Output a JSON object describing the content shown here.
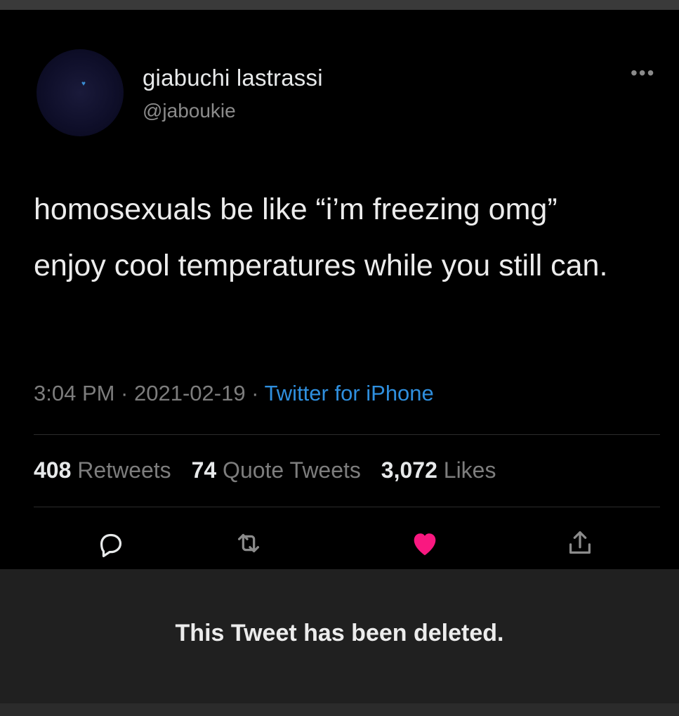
{
  "tweet": {
    "author": {
      "display_name": "giabuchi lastrassi",
      "handle": "@jaboukie",
      "avatar_icon": "avatar-image"
    },
    "more_icon": "more-horizontal-icon",
    "text": "homosexuals be like “i’m freezing omg” enjoy cool temperatures while you still can.",
    "timestamp": "3:04 PM · 2021-02-19 · ",
    "source": "Twitter for iPhone",
    "stats": {
      "retweets_count": "408",
      "retweets_label": "Retweets",
      "quotes_count": "74",
      "quotes_label": "Quote Tweets",
      "likes_count": "3,072",
      "likes_label": "Likes"
    },
    "actions": {
      "reply_icon": "reply-icon",
      "retweet_icon": "retweet-icon",
      "like_icon": "heart-icon",
      "share_icon": "share-icon"
    },
    "liked": true,
    "colors": {
      "background": "#000000",
      "link": "#2f8fde",
      "heart": "#f91880",
      "muted": "#7d7d7d",
      "deleted_panel": "#202020"
    }
  },
  "notice": {
    "deleted_text": "This Tweet has been deleted."
  }
}
